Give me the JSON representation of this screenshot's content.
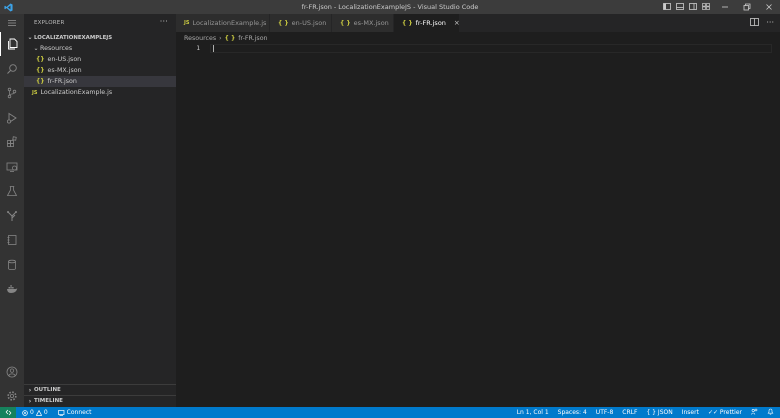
{
  "window": {
    "title": "fr-FR.json - LocalizationExampleJS - Visual Studio Code"
  },
  "activity_bar": {
    "items": [
      "explorer-icon",
      "search-icon",
      "source-control-icon",
      "run-debug-icon",
      "extensions-icon",
      "remote-explorer-icon",
      "testing-icon",
      "git-graph-icon",
      "notebook-icon",
      "database-icon",
      "docker-icon"
    ],
    "bottom": [
      "account-icon",
      "manage-gear-icon"
    ]
  },
  "sidebar": {
    "header": "EXPLORER",
    "more": "···",
    "root": "LOCALIZATIONEXAMPLEJS",
    "tree": [
      {
        "label": "Resources",
        "kind": "folder"
      },
      {
        "label": "en-US.json",
        "kind": "json"
      },
      {
        "label": "es-MX.json",
        "kind": "json"
      },
      {
        "label": "fr-FR.json",
        "kind": "json",
        "selected": true
      },
      {
        "label": "LocalizationExample.js",
        "kind": "js"
      }
    ],
    "outline": "OUTLINE",
    "timeline": "TIMELINE"
  },
  "tabs": [
    {
      "label": "LocalizationExample.js",
      "icon": "JS",
      "active": false
    },
    {
      "label": "en-US.json",
      "icon": "{ }",
      "active": false
    },
    {
      "label": "es-MX.json",
      "icon": "{ }",
      "active": false
    },
    {
      "label": "fr-FR.json",
      "icon": "{ }",
      "active": true
    }
  ],
  "tab_close": "×",
  "breadcrumb": {
    "folder": "Resources",
    "file": "fr-FR.json",
    "file_icon": "{ }"
  },
  "editor": {
    "line_number": "1"
  },
  "status_bar": {
    "errors": "0",
    "warnings": "0",
    "connect": "Connect",
    "position": "Ln 1, Col 1",
    "spaces": "Spaces: 4",
    "encoding": "UTF-8",
    "eol": "CRLF",
    "language": "JSON",
    "language_icon": "{ }",
    "insert": "Insert",
    "prettier": "Prettier"
  },
  "colors": {
    "status_bar": "#007acc",
    "remote": "#16825d",
    "json_icon": "#cbcb41"
  }
}
